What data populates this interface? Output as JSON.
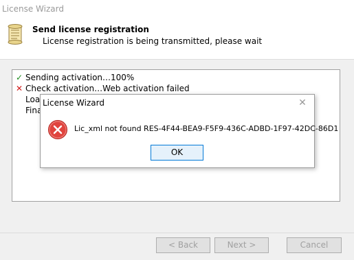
{
  "window": {
    "title": "License Wizard"
  },
  "header": {
    "title": "Send license registration",
    "subtitle": "License registration is being transmitted, please wait",
    "icon": "scroll-icon"
  },
  "log": {
    "lines": [
      {
        "status": "success",
        "icon": "checkmark-icon",
        "text": "Sending activation…100%"
      },
      {
        "status": "failed",
        "icon": "cross-icon",
        "text": "Check activation…Web activation failed"
      },
      {
        "status": "none",
        "text": "Loa"
      },
      {
        "status": "none",
        "text": "Fina"
      }
    ]
  },
  "buttons": {
    "back": "< Back",
    "next": "Next >",
    "cancel": "Cancel"
  },
  "dialog": {
    "title": "License Wizard",
    "close_glyph": "✕",
    "message": "Lic_xml not found RES-4F44-BEA9-F5F9-436C-ADBD-1F97-42DC-86D1",
    "ok_label": "OK",
    "icon": "error-icon"
  },
  "colors": {
    "success": "#1a8a1a",
    "failed": "#d11a1a",
    "error_icon": "#e0443e",
    "ok_border": "#0078d7"
  }
}
